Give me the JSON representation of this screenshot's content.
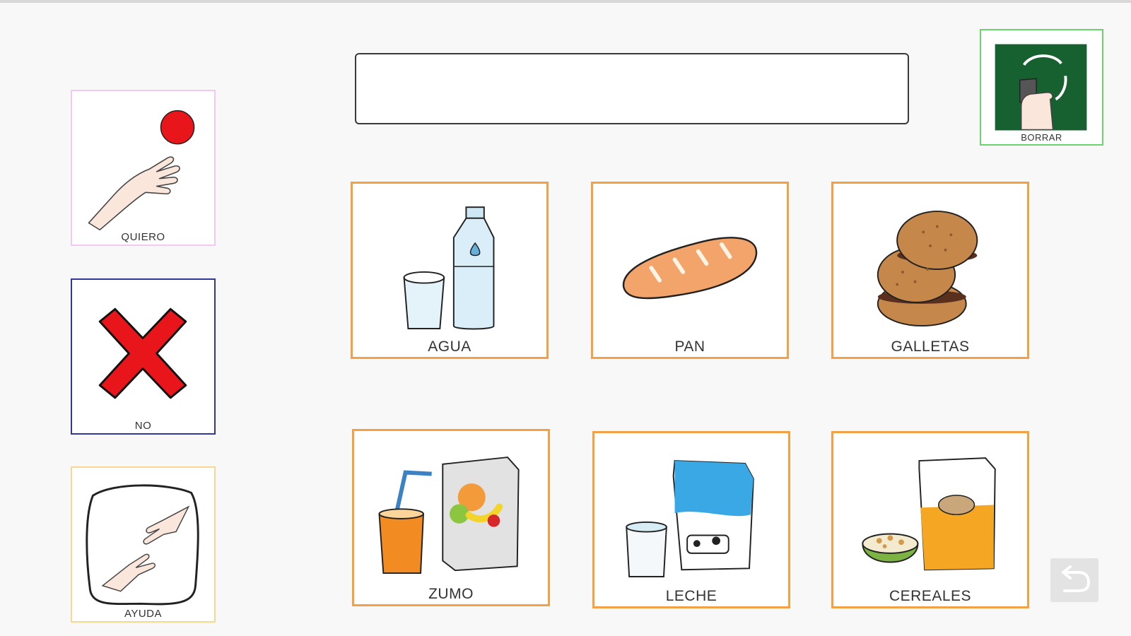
{
  "sentence": {
    "text": ""
  },
  "clear_button": {
    "label": "BORRAR"
  },
  "side_cards": [
    {
      "label": "QUIERO"
    },
    {
      "label": "NO"
    },
    {
      "label": "AYUDA"
    }
  ],
  "food_cards": [
    {
      "label": "AGUA"
    },
    {
      "label": "PAN"
    },
    {
      "label": "GALLETAS"
    },
    {
      "label": "ZUMO"
    },
    {
      "label": "LECHE"
    },
    {
      "label": "CEREALES"
    }
  ],
  "icons": {
    "quiero": "hand-reaching-ball-icon",
    "no": "red-cross-icon",
    "ayuda": "helping-hands-icon",
    "borrar": "eraser-hand-icon",
    "agua": "water-bottle-glass-icon",
    "pan": "bread-loaf-icon",
    "galletas": "cookies-icon",
    "zumo": "juice-box-glass-icon",
    "leche": "milk-carton-glass-icon",
    "cereales": "cereal-box-bowl-icon",
    "undo": "undo-arrow-icon"
  },
  "colors": {
    "food_border": "#f4a044",
    "quiero_border": "#f4c8f0",
    "no_border": "#35359a",
    "ayuda_border": "#f8d890",
    "borrar_border": "#6cd46c",
    "borrar_bg": "#17602f"
  }
}
